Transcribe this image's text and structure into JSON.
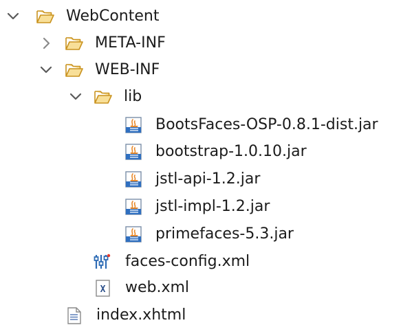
{
  "tree": {
    "root": {
      "label": "WebContent",
      "expanded": true,
      "icon": "folder-icon"
    },
    "meta_inf": {
      "label": "META-INF",
      "expanded": false,
      "icon": "folder-icon"
    },
    "web_inf": {
      "label": "WEB-INF",
      "expanded": true,
      "icon": "folder-icon"
    },
    "lib": {
      "label": "lib",
      "expanded": true,
      "icon": "folder-icon"
    },
    "jars": [
      {
        "label": "BootsFaces-OSP-0.8.1-dist.jar",
        "icon": "jar-icon"
      },
      {
        "label": "bootstrap-1.0.10.jar",
        "icon": "jar-icon"
      },
      {
        "label": "jstl-api-1.2.jar",
        "icon": "jar-icon"
      },
      {
        "label": "jstl-impl-1.2.jar",
        "icon": "jar-icon"
      },
      {
        "label": "primefaces-5.3.jar",
        "icon": "jar-icon"
      }
    ],
    "faces_config": {
      "label": "faces-config.xml",
      "icon": "faces-config-icon"
    },
    "web_xml": {
      "label": "web.xml",
      "icon": "xml-file-icon"
    },
    "index": {
      "label": "index.xhtml",
      "icon": "html-file-icon"
    }
  },
  "colors": {
    "folder_fill": "#f8df98",
    "folder_stroke": "#c9921e",
    "chevron": "#5a5a5a",
    "jar_blue": "#2f6fc0",
    "jar_orange": "#e88a2c"
  }
}
